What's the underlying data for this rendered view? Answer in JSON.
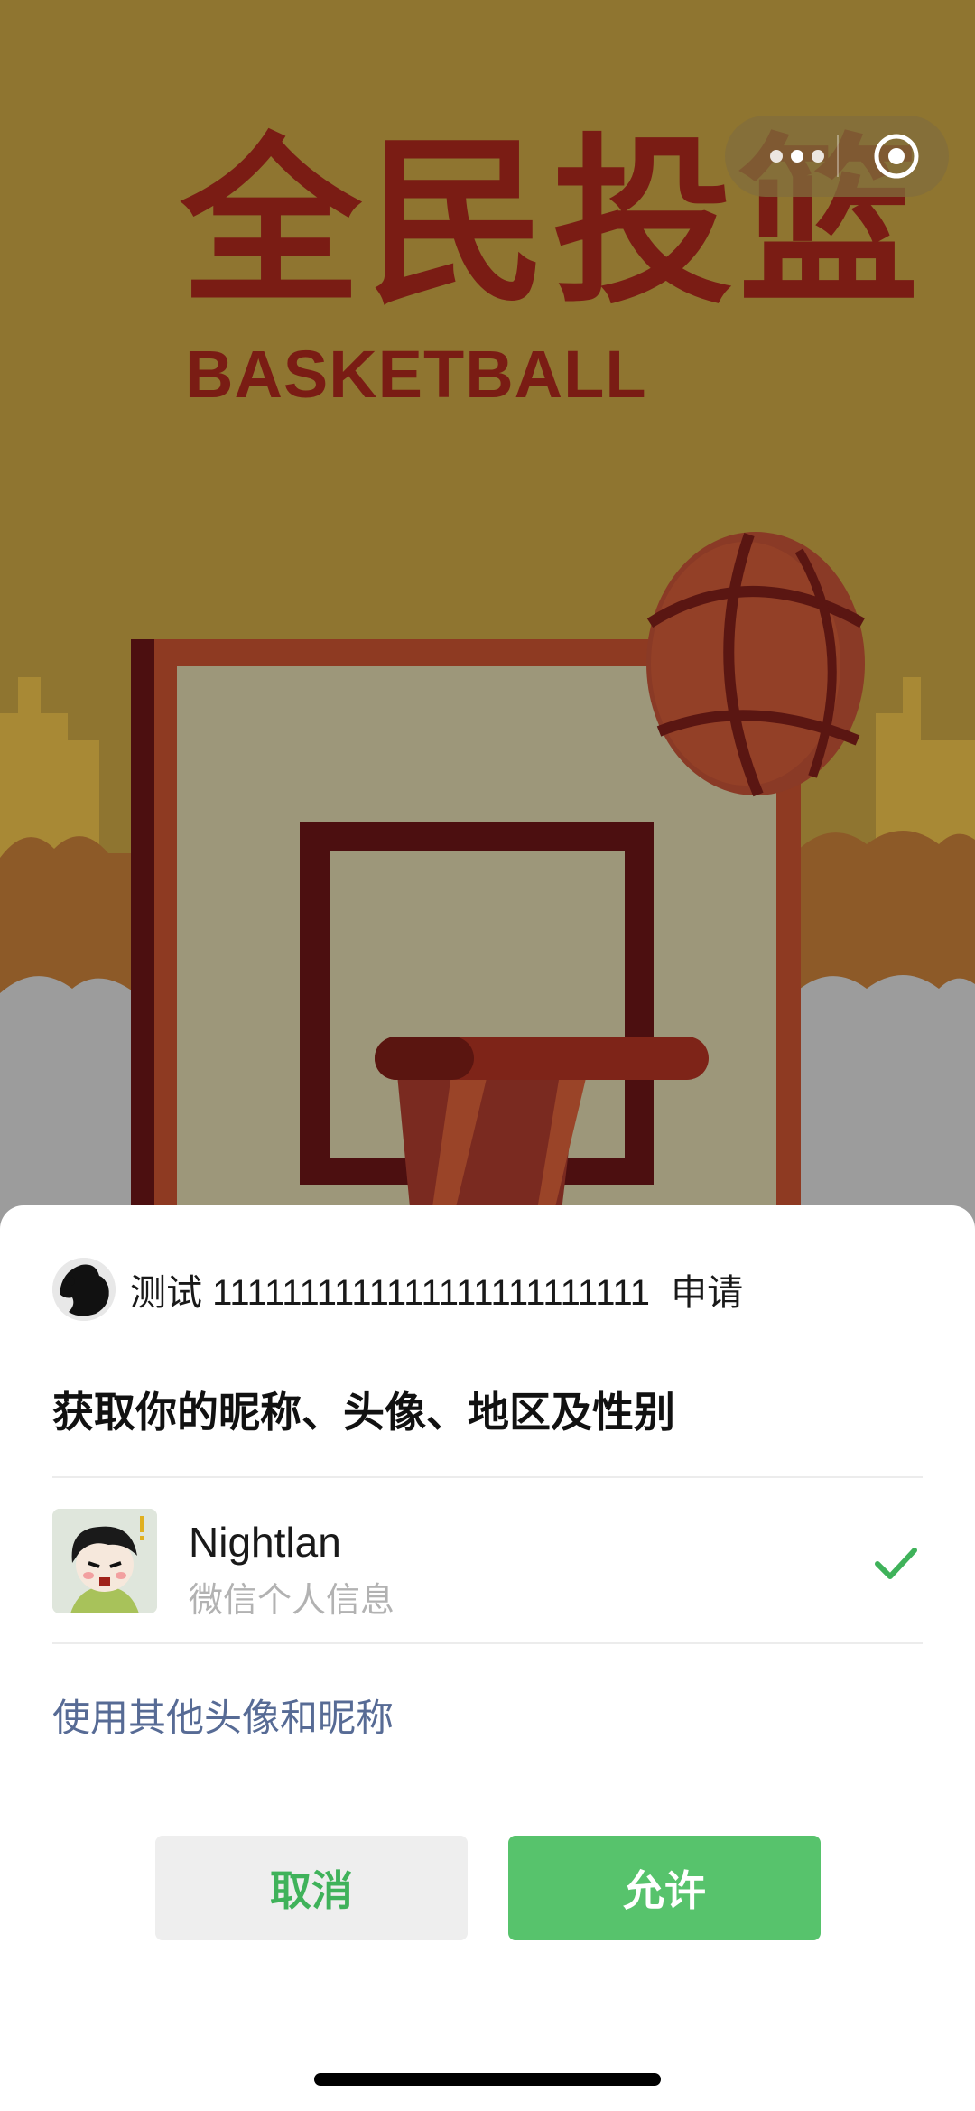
{
  "game": {
    "title_cn": "全民投篮",
    "title_en": "BASKETBALL"
  },
  "capsule": {
    "more_icon": "more-dots-icon",
    "close_icon": "target-close-icon"
  },
  "auth_sheet": {
    "app_name": "测试 1111111111111111111111111",
    "request_word": "申请",
    "permission_title": "获取你的昵称、头像、地区及性别",
    "profile": {
      "nickname": "Nightlan",
      "subtitle": "微信个人信息",
      "selected": true
    },
    "other_link": "使用其他头像和昵称",
    "cancel_label": "取消",
    "allow_label": "允许"
  },
  "colors": {
    "background": "#8f7530",
    "title": "#7a1c14",
    "allow_green": "#57c36c",
    "cancel_text_green": "#3fb25a",
    "link_blue": "#576b95"
  }
}
